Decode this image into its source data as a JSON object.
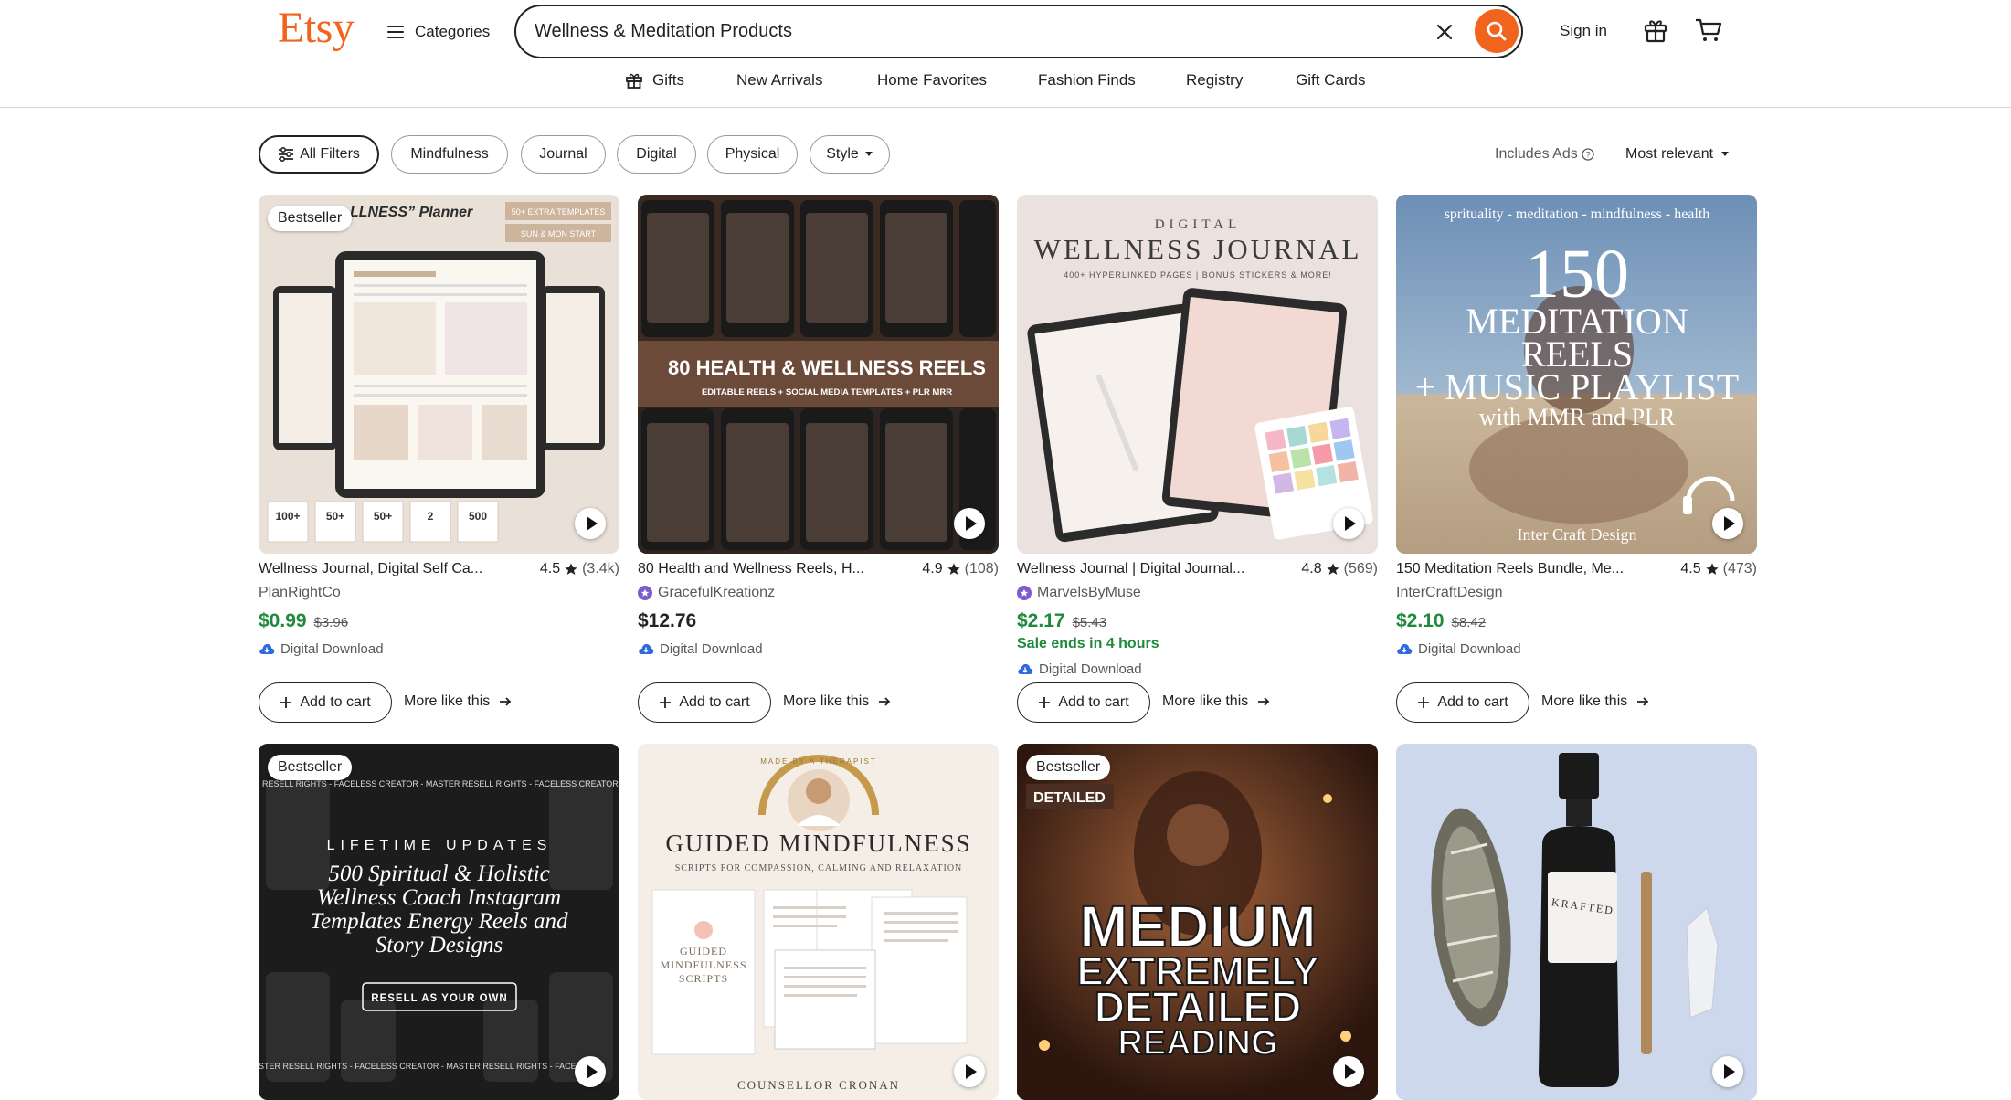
{
  "header": {
    "logo": "Etsy",
    "categories_label": "Categories",
    "search_value": "Wellness & Meditation Products",
    "signin_label": "Sign in",
    "brand_color": "#f1641e"
  },
  "nav": {
    "items": [
      {
        "label": "Gifts",
        "icon": "gift-icon"
      },
      {
        "label": "New Arrivals"
      },
      {
        "label": "Home Favorites"
      },
      {
        "label": "Fashion Finds"
      },
      {
        "label": "Registry"
      },
      {
        "label": "Gift Cards"
      }
    ]
  },
  "filters": {
    "all_filters_label": "All Filters",
    "chips": [
      "Mindfulness",
      "Journal",
      "Digital",
      "Physical",
      "Style"
    ],
    "ads_label": "Includes Ads",
    "sort_label": "Most relevant"
  },
  "listings": [
    {
      "badge": "Bestseller",
      "image_text": {
        "heading": "LLNESS” Planner",
        "sub": "50+ EXTRA TEMPLATES",
        "sub2": "SUN & MON START",
        "stats": [
          "100+",
          "50+",
          "50+",
          "2",
          "500"
        ]
      },
      "title": "Wellness Journal, Digital Self Ca...",
      "rating": "4.5",
      "reviews": "(3.4k)",
      "shop": "PlanRightCo",
      "price": "$0.99",
      "original_price": "$3.96",
      "delivery": "Digital Download",
      "add_to_cart": "Add to cart",
      "more_like_this": "More like this"
    },
    {
      "image_text": {
        "heading": "80 HEALTH & WELLNESS REELS",
        "sub": "EDITABLE REELS  +  SOCIAL MEDIA TEMPLATES  +  PLR MRR"
      },
      "title": "80 Health and Wellness Reels, H...",
      "rating": "4.9",
      "reviews": "(108)",
      "shop": "GracefulKreationz",
      "price": "$12.76",
      "delivery": "Digital Download",
      "add_to_cart": "Add to cart",
      "more_like_this": "More like this"
    },
    {
      "image_text": {
        "kicker": "DIGITAL",
        "heading": "WELLNESS JOURNAL",
        "sub": "400+ HYPERLINKED PAGES | BONUS STICKERS & MORE!"
      },
      "title": "Wellness Journal | Digital Journal...",
      "rating": "4.8",
      "reviews": "(569)",
      "shop": "MarvelsByMuse",
      "price": "$2.17",
      "original_price": "$5.43",
      "sale_ends": "Sale ends in 4 hours",
      "delivery": "Digital Download",
      "add_to_cart": "Add to cart",
      "more_like_this": "More like this"
    },
    {
      "image_text": {
        "kicker": "sprituality - meditation - mindfulness - health",
        "big": "150",
        "line1": "MEDITATION",
        "line2": "REELS",
        "line3": "+ MUSIC PLAYLIST",
        "line4": "with MMR and PLR",
        "footer": "Inter Craft Design"
      },
      "title": "150 Meditation Reels Bundle, Me...",
      "rating": "4.5",
      "reviews": "(473)",
      "shop": "InterCraftDesign",
      "price": "$2.10",
      "original_price": "$8.42",
      "delivery": "Digital Download",
      "add_to_cart": "Add to cart",
      "more_like_this": "More like this"
    },
    {
      "badge": "Bestseller",
      "image_text": {
        "ticker": "RESELL RIGHTS - FACELESS CREATOR - MASTER RESELL RIGHTS - FACELESS CREATOR -",
        "kicker": "LIFETIME UPDATES",
        "heading": "500 Spiritual & Holistic Wellness Coach Instagram Templates Energy Reels and Story Designs",
        "button": "RESELL AS YOUR OWN",
        "ticker2": "STER RESELL RIGHTS - FACELESS CREATOR - MASTER RESELL RIGHTS - FACEL"
      }
    },
    {
      "image_text": {
        "arc": "MADE BY A THERAPIST",
        "heading": "GUIDED MINDFULNESS",
        "sub": "SCRIPTS FOR COMPASSION, CALMING AND RELAXATION",
        "book": "GUIDED MINDFULNESS SCRIPTS",
        "footer": "COUNSELLOR CRONAN"
      }
    },
    {
      "badge": "Bestseller",
      "image_text": {
        "tag": "DETAILED",
        "line1": "MEDIUM",
        "line2": "EXTREMELY",
        "line3": "DETAILED",
        "line4": "READING"
      }
    },
    {
      "image_text": {
        "label": "KRAFTED"
      }
    }
  ]
}
